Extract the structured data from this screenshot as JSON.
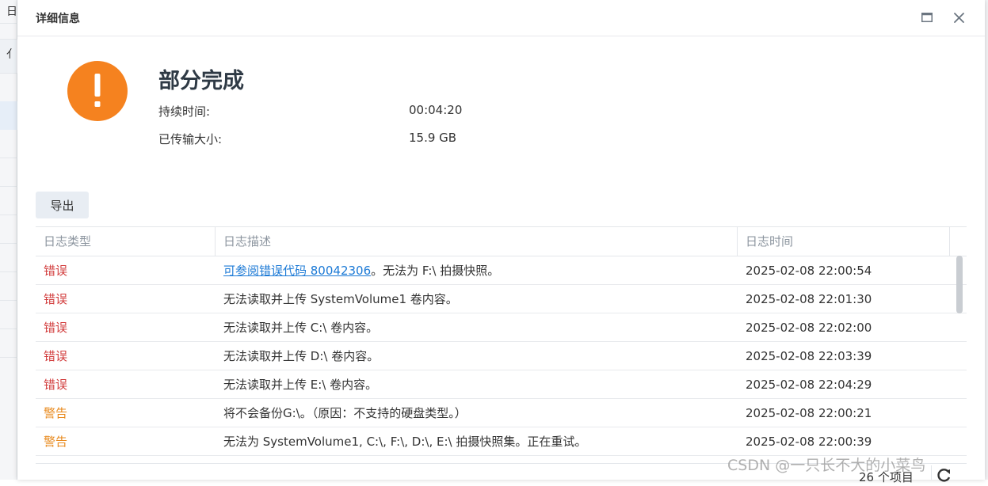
{
  "background_app": {
    "row_labels": [
      "日",
      "亻"
    ]
  },
  "dialog": {
    "title": "详细信息",
    "maximize_icon": "maximize-icon",
    "close_icon": "close-icon",
    "status": {
      "icon": "exclamation-icon",
      "icon_color": "#f5821f",
      "title": "部分完成",
      "duration_label": "持续时间:",
      "duration_value": "00:04:20",
      "transferred_label": "已传输大小:",
      "transferred_value": "15.9 GB"
    },
    "export_label": "导出",
    "grid": {
      "headers": [
        "日志类型",
        "日志描述",
        "日志时间"
      ],
      "rows": [
        {
          "type": "错误",
          "level": "error",
          "link": "可参阅错误代码 80042306",
          "desc": "。无法为 F:\\ 拍摄快照。",
          "time": "2025-02-08 22:00:54"
        },
        {
          "type": "错误",
          "level": "error",
          "link": "",
          "desc": "无法读取并上传 SystemVolume1 卷内容。",
          "time": "2025-02-08 22:01:30"
        },
        {
          "type": "错误",
          "level": "error",
          "link": "",
          "desc": "无法读取并上传 C:\\ 卷内容。",
          "time": "2025-02-08 22:02:00"
        },
        {
          "type": "错误",
          "level": "error",
          "link": "",
          "desc": "无法读取并上传 D:\\ 卷内容。",
          "time": "2025-02-08 22:03:39"
        },
        {
          "type": "错误",
          "level": "error",
          "link": "",
          "desc": "无法读取并上传 E:\\ 卷内容。",
          "time": "2025-02-08 22:04:29"
        },
        {
          "type": "警告",
          "level": "warning",
          "link": "",
          "desc": "将不会备份G:\\。（原因：不支持的硬盘类型。）",
          "time": "2025-02-08 22:00:21"
        },
        {
          "type": "警告",
          "level": "warning",
          "link": "",
          "desc": "无法为 SystemVolume1, C:\\, F:\\, D:\\, E:\\ 拍摄快照集。正在重试。",
          "time": "2025-02-08 22:00:39"
        }
      ]
    },
    "footer": {
      "count": "26 个项目",
      "refresh_icon": "refresh-icon"
    }
  },
  "colors": {
    "error": "#d23c3c",
    "warning": "#e8891c",
    "link": "#1c7ad6"
  },
  "watermark": "CSDN @一只长不大的小菜鸟"
}
